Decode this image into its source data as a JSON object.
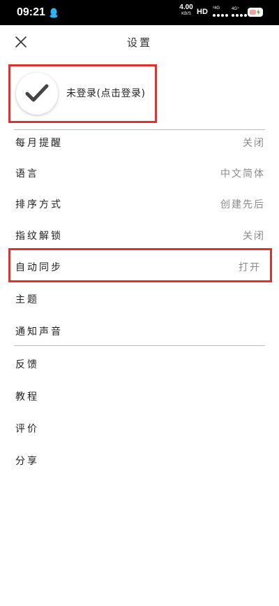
{
  "status_bar": {
    "time": "09:21",
    "net_speed": "4.00",
    "net_speed_unit": "KB/S",
    "hd": "HD",
    "sim1_label": "²4G",
    "sim2_label": "4G⁺"
  },
  "header": {
    "title": "设置"
  },
  "account": {
    "login_text": "未登录(点击登录)"
  },
  "settings": {
    "rows": [
      {
        "label": "每月提醒",
        "value": "关闭"
      },
      {
        "label": "语言",
        "value": "中文简体"
      },
      {
        "label": "排序方式",
        "value": "创建先后"
      },
      {
        "label": "指纹解锁",
        "value": "关闭"
      },
      {
        "label": "自动同步",
        "value": "打开"
      },
      {
        "label": "主题",
        "value": ""
      },
      {
        "label": "通知声音",
        "value": ""
      }
    ],
    "more": [
      {
        "label": "反馈"
      },
      {
        "label": "教程"
      },
      {
        "label": "评价"
      },
      {
        "label": "分享"
      }
    ]
  },
  "colors": {
    "highlight": "#e03030",
    "value_text": "#8a8a8a"
  }
}
